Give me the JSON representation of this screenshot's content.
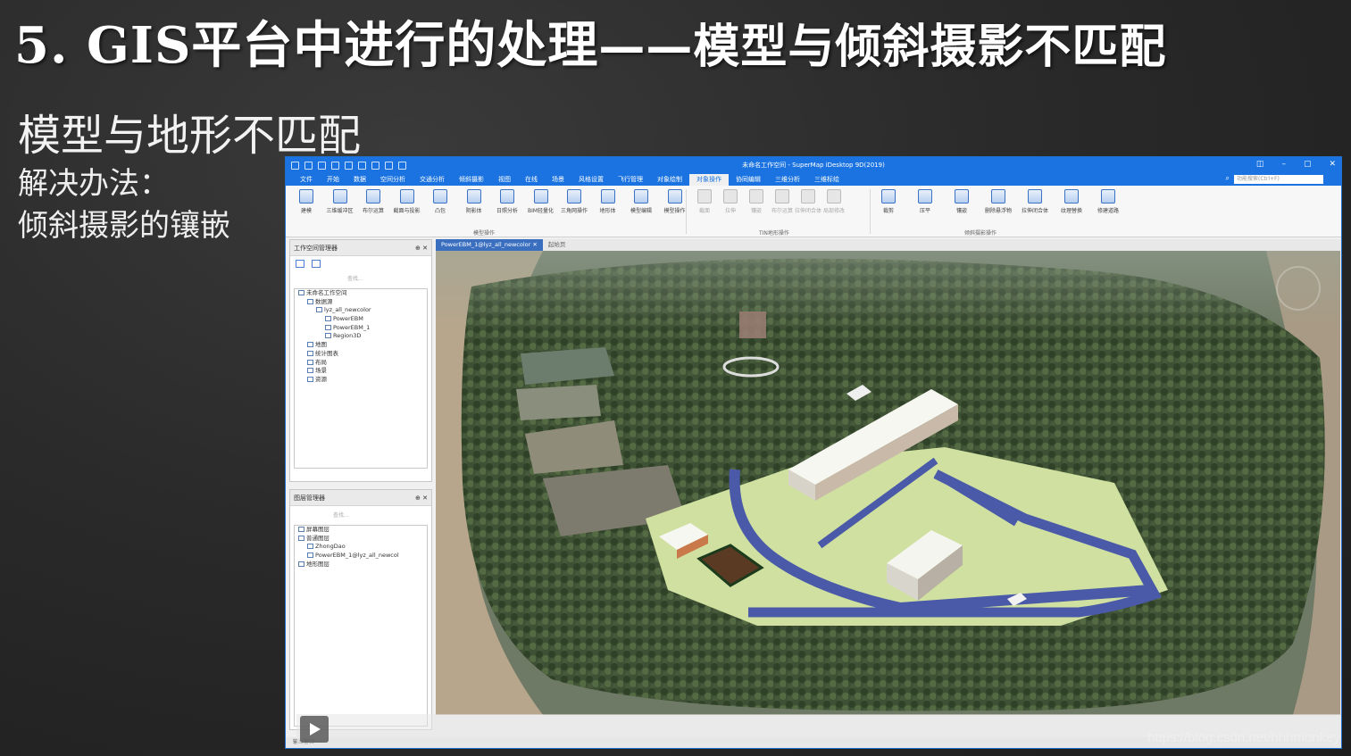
{
  "slide": {
    "title_main": "5. GIS平台中进行的处理",
    "title_suffix": "——模型与倾斜摄影不匹配",
    "subtitle": "模型与地形不匹配",
    "solution_label": "解决办法：",
    "solution_text": "倾斜摄影的镶嵌"
  },
  "app": {
    "window_title": "未命名工作空间 - SuperMap iDesktop 9D(2019)",
    "menu": [
      "文件",
      "开始",
      "数据",
      "空间分析",
      "交通分析",
      "倾斜摄影",
      "视图",
      "在线",
      "场景",
      "风格设置",
      "飞行管理",
      "对象绘制",
      "对象操作",
      "协同编辑",
      "三维分析",
      "三维标绘"
    ],
    "active_menu_index": 12,
    "search_placeholder": "功能搜索(Ctrl+F)",
    "ribbon": {
      "model_group": [
        "建模",
        "三维缓冲区",
        "布尔运算",
        "截面与投影",
        "凸包",
        "阴影体",
        "日照分析",
        "BIM轻量化",
        "三角网操作",
        "地形体",
        "模型编辑",
        "模型操作"
      ],
      "tin_group": [
        "截面",
        "拉伸",
        "镶嵌",
        "布尔运算",
        "拉伸闭合体",
        "局部修改"
      ],
      "oblique_group": [
        "裁剪",
        "压平",
        "镶嵌",
        "删除悬浮物",
        "拉伸闭合体",
        "纹理替换",
        "修建道路"
      ],
      "group_labels": {
        "model": "模型操作",
        "tin": "TIN地形操作",
        "oblique": "倾斜摄影操作"
      }
    },
    "workspace_panel": {
      "title": "工作空间管理器",
      "search": "查找...",
      "tree": [
        {
          "label": "未命名工作空间",
          "indent": 0
        },
        {
          "label": "数据源",
          "indent": 1
        },
        {
          "label": "lyz_all_newcolor",
          "indent": 2
        },
        {
          "label": "PowerEBM",
          "indent": 3
        },
        {
          "label": "PowerEBM_1",
          "indent": 3
        },
        {
          "label": "Region3D",
          "indent": 3
        },
        {
          "label": "地图",
          "indent": 1
        },
        {
          "label": "统计图表",
          "indent": 1
        },
        {
          "label": "布局",
          "indent": 1
        },
        {
          "label": "场景",
          "indent": 1
        },
        {
          "label": "资源",
          "indent": 1
        }
      ]
    },
    "layer_panel": {
      "title": "图层管理器",
      "search": "查找...",
      "tree": [
        {
          "label": "屏幕图层",
          "indent": 0
        },
        {
          "label": "普通图层",
          "indent": 0
        },
        {
          "label": "ZhongDao",
          "indent": 1
        },
        {
          "label": "PowerEBM_1@lyz_all_newcol",
          "indent": 1
        },
        {
          "label": "地形图层",
          "indent": 0
        }
      ]
    },
    "doc_tabs": [
      {
        "label": "PowerEBM_1@lyz_all_newcolor",
        "active": true
      },
      {
        "label": "起始页",
        "active": false
      }
    ],
    "status_text": "输出窗口"
  },
  "watermark": "https://blog.csdn.net/hhhmonkey",
  "icons": {
    "play": "play-icon",
    "compass": "compass-icon",
    "close": "close-icon",
    "pin": "pin-icon"
  },
  "colors": {
    "accent": "#1a73e0",
    "road": "#4a5aa8",
    "lawn": "#cfe0a0",
    "forest": "#3e4f33"
  }
}
